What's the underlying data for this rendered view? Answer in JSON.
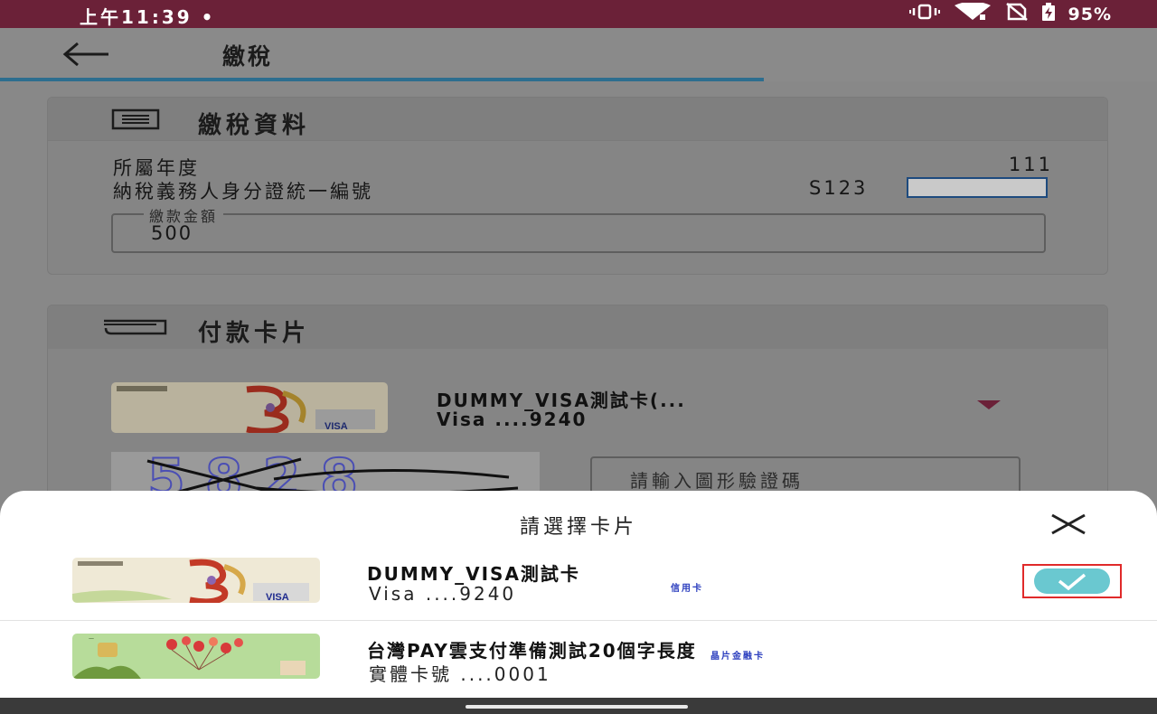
{
  "status_bar": {
    "time": "上午11:39",
    "dot": "•",
    "battery": "95%",
    "icons": [
      "vibrate-icon",
      "wifi-icon",
      "no-sim-icon",
      "battery-icon"
    ]
  },
  "app_bar": {
    "title": "繳稅",
    "back_icon": "arrow-left-icon",
    "progress_fraction": 0.66
  },
  "tax_info": {
    "title": "繳稅資料",
    "icon": "receipt-icon",
    "year_label": "所屬年度",
    "year_value": "111",
    "id_label": "納稅義務人身分證統一編號",
    "id_value": "S123",
    "amount_label": "繳款金額",
    "amount_value": "500"
  },
  "payment_card": {
    "title": "付款卡片",
    "icon": "card-icon",
    "selected_name": "DUMMY_VISA測試卡(...",
    "selected_number": "Visa ....9240",
    "dropdown_icon": "triangle-down-icon",
    "captcha_text": "5828",
    "captcha_placeholder": "請輸入圖形驗證碼"
  },
  "sheet": {
    "title": "請選擇卡片",
    "close_icon": "close-icon",
    "options": [
      {
        "name": "DUMMY_VISA測試卡",
        "number": "Visa ....9240",
        "type": "信用卡",
        "selected": true,
        "brand": "VISA"
      },
      {
        "name": "台灣PAY雲支付準備測試20個字長度",
        "number": "實體卡號 ....0001",
        "type": "晶片金融卡",
        "selected": false
      }
    ]
  },
  "colors": {
    "status_bar": "#6b2138",
    "accent": "#6b2138",
    "progress": "#2d6e8f",
    "check": "#6ac8d0",
    "highlight_box": "#e02a2a"
  }
}
